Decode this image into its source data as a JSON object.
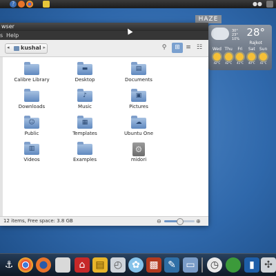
{
  "top_panel": {
    "items": [
      "help-icon",
      "firefox-icon",
      "chrome-icon",
      "notes-icon"
    ],
    "tray": [
      "user-icon",
      "power-icon"
    ],
    "help_glyph": "?",
    "tray_glyph": "●●"
  },
  "weather_widget": {
    "label": "HAZE",
    "temperature": "28°",
    "city": "Rajkot",
    "details": [
      "30°",
      "23°",
      "10%"
    ],
    "days": [
      {
        "day": "Wed",
        "temp": "42°C"
      },
      {
        "day": "Thu",
        "temp": "42°C"
      },
      {
        "day": "Fri",
        "temp": "41°C"
      },
      {
        "day": "Sat",
        "temp": "40°C"
      },
      {
        "day": "Sun",
        "temp": "41°C"
      }
    ]
  },
  "window": {
    "title": "wser",
    "menu": [
      "s",
      "Help"
    ],
    "path": {
      "back": "◂",
      "current": "kushal",
      "next": "▸"
    },
    "toolbar": {
      "search_glyph": "⚲",
      "icon_view_glyph": "⊞",
      "list_view_glyph": "≡",
      "compact_view_glyph": "☷"
    },
    "items": [
      {
        "label": "Calibre Library",
        "icon": "folder",
        "glyph": ""
      },
      {
        "label": "Desktop",
        "icon": "folder-desktop",
        "glyph": "▬"
      },
      {
        "label": "Documents",
        "icon": "folder-documents",
        "glyph": "▤"
      },
      {
        "label": "Downloads",
        "icon": "folder",
        "glyph": ""
      },
      {
        "label": "Music",
        "icon": "folder-music",
        "glyph": "♪"
      },
      {
        "label": "Pictures",
        "icon": "folder-pictures",
        "glyph": "▣"
      },
      {
        "label": "Public",
        "icon": "folder-public",
        "glyph": "☺"
      },
      {
        "label": "Templates",
        "icon": "folder-templates",
        "glyph": "▦"
      },
      {
        "label": "Ubuntu One",
        "icon": "folder-ubuntu-one",
        "glyph": "☁"
      },
      {
        "label": "Videos",
        "icon": "folder-videos",
        "glyph": "▥"
      },
      {
        "label": "Examples",
        "icon": "folder",
        "glyph": ""
      },
      {
        "label": "midori",
        "icon": "midori-file",
        "glyph": "⚙"
      }
    ],
    "status": "12 items, Free space: 3.8 GB",
    "zoom": {
      "out_glyph": "⊖",
      "in_glyph": "⊕",
      "level_fraction": 0.5
    }
  },
  "dock": {
    "icons": [
      "anchor-icon",
      "chrome-icon",
      "firefox-icon",
      "disk-utility-icon",
      "pdf-reader-icon",
      "archive-manager-icon",
      "time-machine-icon",
      "brain-icon",
      "photo-viewer-icon",
      "text-editor-icon",
      "files-icon",
      "trash-separator-icon",
      "clock-icon",
      "green-circle-icon",
      "system-monitor-icon",
      "settings-icon"
    ],
    "glyphs": {
      "anchor": "⚓",
      "pdf": "⌂",
      "archive": "▤",
      "time": "◴",
      "brain": "✿",
      "photo": "▩",
      "text": "✎",
      "files": "▭",
      "clock": "◷",
      "monitor": "▮",
      "settings": "✣"
    }
  }
}
